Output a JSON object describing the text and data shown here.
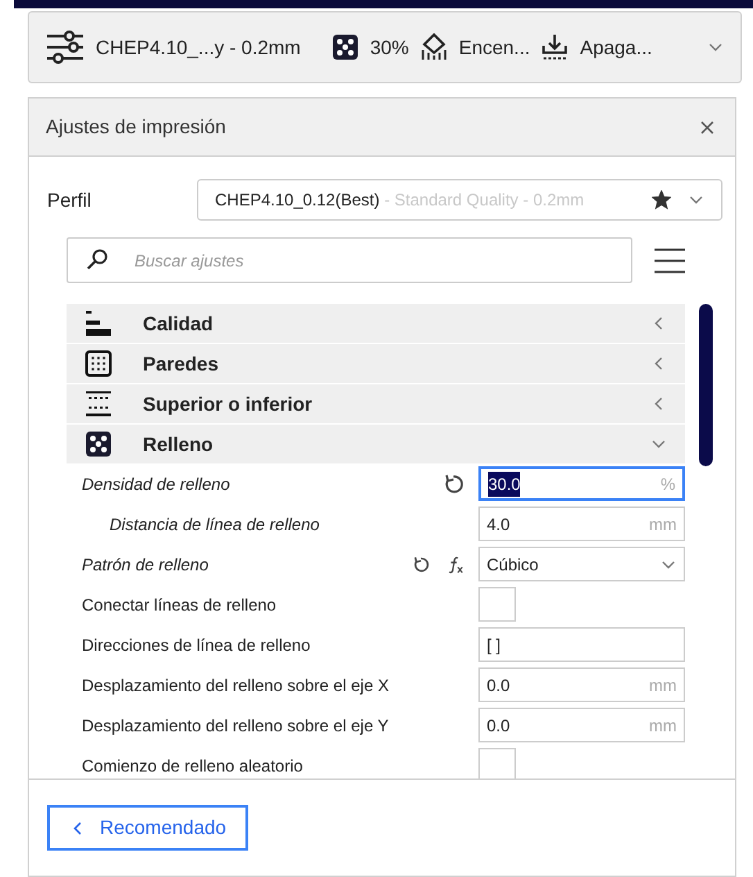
{
  "top_bar": {
    "profile": "CHEP4.10_...y - 0.2mm",
    "infill": "30%",
    "support": "Encen...",
    "adhesion": "Apaga..."
  },
  "panel": {
    "title": "Ajustes de impresión",
    "profile": {
      "label": "Perfil",
      "name": "CHEP4.10_0.12(Best)",
      "description": " - Standard Quality - 0.2mm",
      "favorite": true
    },
    "search": {
      "placeholder": "Buscar ajustes"
    },
    "categories": [
      {
        "kind": "quality",
        "label": "Calidad",
        "expanded": false
      },
      {
        "kind": "walls",
        "label": "Paredes",
        "expanded": false
      },
      {
        "kind": "topbottom",
        "label": "Superior o inferior",
        "expanded": false
      },
      {
        "kind": "infill",
        "label": "Relleno",
        "expanded": true
      }
    ],
    "settings": [
      {
        "kind": "number",
        "label": "Densidad de relleno",
        "modified": true,
        "resettable": true,
        "formula": false,
        "value": "30.0",
        "unit": "%",
        "focused": true,
        "children": [
          {
            "kind": "number",
            "label": "Distancia de línea de relleno",
            "modified": true,
            "resettable": false,
            "formula": false,
            "value": "4.0",
            "unit": "mm",
            "focused": false
          }
        ]
      },
      {
        "kind": "combo",
        "label": "Patrón de relleno",
        "modified": true,
        "resettable": true,
        "formula": true,
        "value": "Cúbico"
      },
      {
        "kind": "checkbox",
        "label": "Conectar líneas de relleno",
        "modified": false,
        "resettable": false,
        "formula": false,
        "checked": false
      },
      {
        "kind": "text",
        "label": "Direcciones de línea de relleno",
        "modified": false,
        "resettable": false,
        "formula": false,
        "value": "[ ]"
      },
      {
        "kind": "number",
        "label": "Desplazamiento del relleno sobre el eje X",
        "modified": false,
        "resettable": false,
        "formula": false,
        "value": "0.0",
        "unit": "mm",
        "focused": false
      },
      {
        "kind": "number",
        "label": "Desplazamiento del relleno sobre el eje Y",
        "modified": false,
        "resettable": false,
        "formula": false,
        "value": "0.0",
        "unit": "mm",
        "focused": false
      },
      {
        "kind": "checkbox",
        "label": "Comienzo de relleno aleatorio",
        "modified": false,
        "resettable": false,
        "formula": false,
        "checked": false
      }
    ],
    "back_button": "Recomendado"
  }
}
